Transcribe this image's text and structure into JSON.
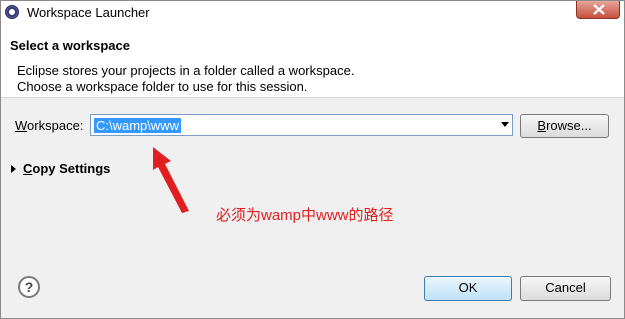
{
  "window": {
    "title": "Workspace Launcher",
    "close_icon": "close-icon"
  },
  "header": {
    "title": "Select a workspace",
    "description_line1": "Eclipse stores your projects in a folder called a workspace.",
    "description_line2": "Choose a workspace folder to use for this session."
  },
  "workspace": {
    "label_prefix": "W",
    "label_rest": "orkspace:",
    "value": "C:\\wamp\\www",
    "dropdown_icon": "chevron-down-icon"
  },
  "browse": {
    "label_prefix": "B",
    "label_rest": "rowse..."
  },
  "copy_settings": {
    "label_prefix": "C",
    "label_rest": "opy Settings",
    "expand_icon": "triangle-right-icon"
  },
  "annotation": {
    "text": "必须为wamp中www的路径",
    "color": "#e02020"
  },
  "buttons": {
    "help_symbol": "?",
    "ok_label": "OK",
    "cancel_label": "Cancel"
  }
}
